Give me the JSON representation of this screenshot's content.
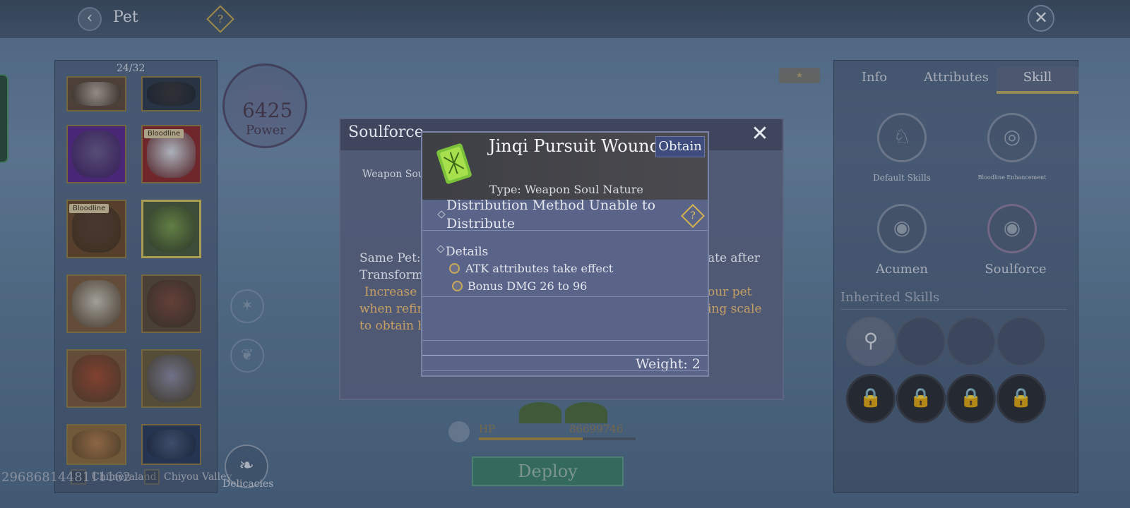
{
  "header": {
    "title": "Pet",
    "back_icon": "chevron-left-icon",
    "help_glyph": "?",
    "close_glyph": "✕"
  },
  "pet_list": {
    "count": "24/32",
    "tag_label": "Bloodline",
    "slots": [
      {
        "name": "white-wolf",
        "color": "#b6a89a",
        "bg": "#5e4a3a"
      },
      {
        "name": "black-beast",
        "color": "#3a3638",
        "bg": "#2f3a4a"
      },
      {
        "name": "purple-dragon",
        "color": "#6a5a8a",
        "bg": "#5a2a8a",
        "bloodline": false
      },
      {
        "name": "white-dragon",
        "color": "#d8dbe2",
        "bg": "#8a2a2a",
        "bloodline": true
      },
      {
        "name": "fierce-beast",
        "color": "#5a4030",
        "bg": "#6a4a2a",
        "bloodline": true
      },
      {
        "name": "green-frog",
        "color": "#7a9a4a",
        "bg": "#4a5a3a",
        "selected": true
      },
      {
        "name": "bone-dragon",
        "color": "#c8c4b6",
        "bg": "#7a5a3a"
      },
      {
        "name": "fire-horse",
        "color": "#7a4a3a",
        "bg": "#5a4a3a"
      },
      {
        "name": "red-squirrel",
        "color": "#a04a30",
        "bg": "#7a5a3a"
      },
      {
        "name": "woman-face",
        "color": "#8a8aa0",
        "bg": "#6a5a3a"
      },
      {
        "name": "brown-bear",
        "color": "#b07a4a",
        "bg": "#8a6a3a"
      },
      {
        "name": "blue-bird",
        "color": "#4a5a7a",
        "bg": "#2a3a5a"
      }
    ]
  },
  "regions": [
    "Chimeraland",
    "Chiyou Valley"
  ],
  "user_id": "2968681448111162",
  "power": {
    "value": "6425",
    "label": "Power"
  },
  "hp": {
    "label": "HP",
    "value": "86699746",
    "fill": 0.66
  },
  "deploy_label": "Deploy",
  "delicacies_label": "Delicacies",
  "tabs": {
    "info": "Info",
    "attributes": "Attributes",
    "skill": "Skill"
  },
  "skills": {
    "default": "Default Skills",
    "bloodline": "Bloodline Enhancement",
    "acumen": "Acumen",
    "soulforce": "Soulforce"
  },
  "inherited": {
    "title": "Inherited Skills"
  },
  "soulforce_dialog": {
    "title": "Soulforce",
    "subtitle": "Weapon Sou",
    "line1_left": "Same Pet: N",
    "line1_right": "ate after",
    "line2": "Transform",
    "line3_left": "Increase y",
    "line3_right": "our pet",
    "line4_left": "when refin",
    "line4_right": "ing scale",
    "line5": "to obtain h"
  },
  "item": {
    "name": "Jinqi Pursuit Wound",
    "obtain_label": "Obtain",
    "type": "Type: Weapon Soul Nature",
    "distribution": "Distribution Method   Unable to Distribute",
    "details_label": "Details",
    "detail_1": "ATK attributes take effect",
    "detail_2": "Bonus DMG 26 to 96",
    "weight": "Weight: 2"
  }
}
